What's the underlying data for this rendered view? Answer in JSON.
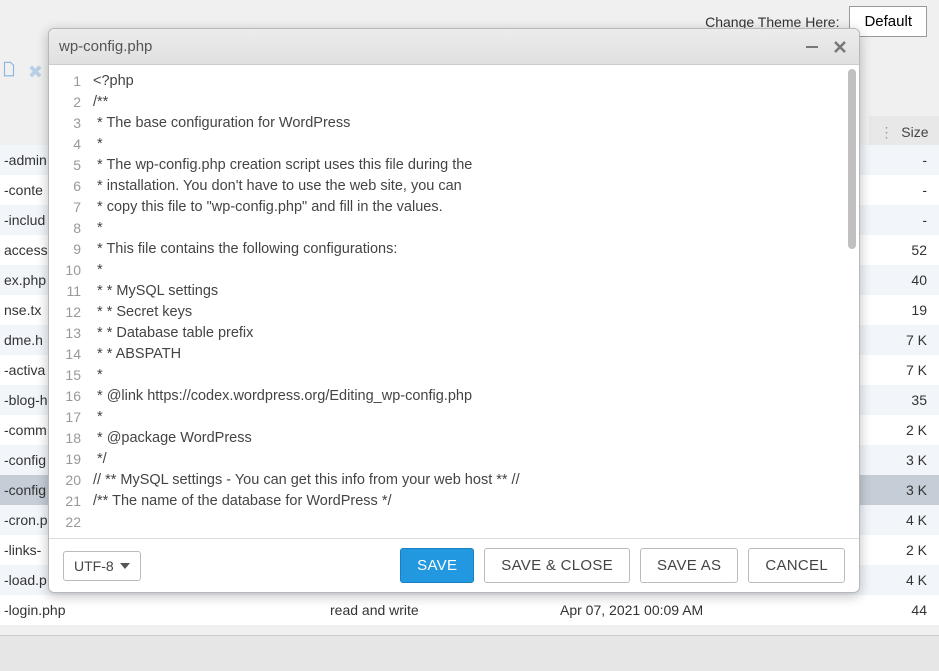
{
  "topbar": {
    "theme_label": "Change Theme Here:",
    "theme_value": "Default"
  },
  "table": {
    "size_header": "Size"
  },
  "files": [
    {
      "name": "-admin",
      "perm": "",
      "date": "",
      "size": "-"
    },
    {
      "name": "-conte",
      "perm": "",
      "date": "",
      "size": "-"
    },
    {
      "name": "-includ",
      "perm": "",
      "date": "",
      "size": "-"
    },
    {
      "name": "access",
      "perm": "",
      "date": "",
      "size": "52"
    },
    {
      "name": "ex.php",
      "perm": "",
      "date": "",
      "size": "40"
    },
    {
      "name": "nse.tx",
      "perm": "",
      "date": "",
      "size": "19"
    },
    {
      "name": "dme.h",
      "perm": "",
      "date": "",
      "size": "7 K"
    },
    {
      "name": "-activa",
      "perm": "",
      "date": "",
      "size": "7 K"
    },
    {
      "name": "-blog-h",
      "perm": "",
      "date": "",
      "size": "35"
    },
    {
      "name": "-comm",
      "perm": "",
      "date": "",
      "size": "2 K"
    },
    {
      "name": "-config",
      "perm": "",
      "date": "",
      "size": "3 K"
    },
    {
      "name": "-config",
      "perm": "",
      "date": "",
      "size": "3 K",
      "selected": true
    },
    {
      "name": "-cron.p",
      "perm": "",
      "date": "",
      "size": "4 K"
    },
    {
      "name": "-links-",
      "perm": "",
      "date": "",
      "size": "2 K"
    },
    {
      "name": "-load.p",
      "perm": "",
      "date": "",
      "size": "4 K"
    },
    {
      "name": "-login.php",
      "perm": "read and write",
      "date": "Apr 07, 2021 00:09 AM",
      "size": "44"
    }
  ],
  "editor": {
    "title": "wp-config.php",
    "encoding": "UTF-8",
    "buttons": {
      "save": "SAVE",
      "save_close": "SAVE & CLOSE",
      "save_as": "SAVE AS",
      "cancel": "CANCEL"
    },
    "lines": [
      "<?php",
      "/**",
      " * The base configuration for WordPress",
      " *",
      " * The wp-config.php creation script uses this file during the",
      " * installation. You don't have to use the web site, you can",
      " * copy this file to \"wp-config.php\" and fill in the values.",
      " *",
      " * This file contains the following configurations:",
      " *",
      " * * MySQL settings",
      " * * Secret keys",
      " * * Database table prefix",
      " * * ABSPATH",
      " *",
      " * @link https://codex.wordpress.org/Editing_wp-config.php",
      " *",
      " * @package WordPress",
      " */",
      "",
      "// ** MySQL settings - You can get this info from your web host ** //",
      "/** The name of the database for WordPress */"
    ]
  }
}
